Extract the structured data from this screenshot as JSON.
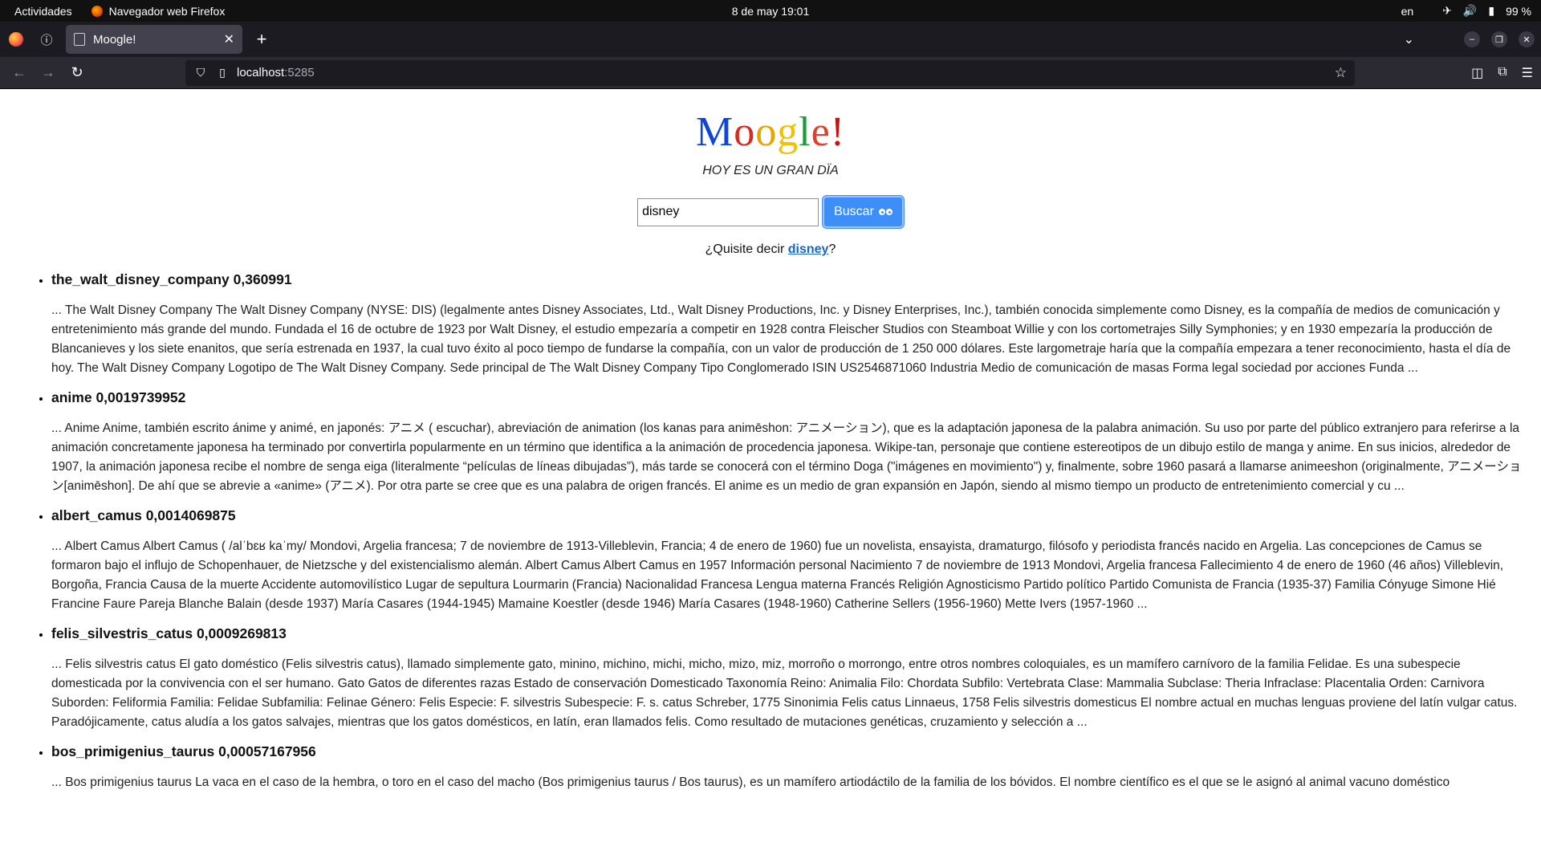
{
  "system": {
    "activities": "Actividades",
    "app_name": "Navegador web Firefox",
    "clock": "8 de may  19:01",
    "language": "en",
    "battery": "99 %"
  },
  "browser": {
    "tab_title": "Moogle!",
    "url_host": "localhost",
    "url_port": ":5285"
  },
  "page": {
    "logo_letters": [
      "M",
      "o",
      "o",
      "g",
      "l",
      "e",
      "!"
    ],
    "tagline": "HOY ES UN GRAN DÏA",
    "search_value": "disney",
    "search_button": "Buscar",
    "suggestion_prefix": "¿Quisite decir ",
    "suggestion_word": "disney",
    "suggestion_suffix": "?",
    "results": [
      {
        "heading": "the_walt_disney_company 0,360991",
        "snippet": "... The Walt Disney Company  The Walt Disney Company (NYSE: DIS) (legalmente antes Disney Associates, Ltd., Walt Disney Productions, Inc. y Disney Enterprises, Inc.), también conocida simplemente como Disney, es la compañía de medios de comunicación y entretenimiento más grande del mundo. Fundada el 16 de octubre de 1923 por Walt Disney, el estudio empezaría a competir en 1928 contra Fleischer Studios con Steamboat Willie y con los cortometrajes Silly Symphonies; y en 1930 empezaría la producción de Blancanieves y los siete enanitos, que sería estrenada en 1937, la cual tuvo éxito al poco tiempo de fundarse la compañía, con un valor de producción de 1 250 000 dólares. Este largometraje haría que la compañía empezara a tener reconocimiento, hasta el día de hoy. The Walt Disney Company  Logotipo de The Walt Disney Company.  Sede principal de The Walt Disney Company Tipo Conglomerado ISIN US2546871060 Industria Medio de comunicación de masas Forma legal sociedad por acciones Funda ..."
      },
      {
        "heading": "anime 0,0019739952",
        "snippet": "... Anime  Anime, también escrito ánime y animé, en japonés: アニメ ( escuchar), abreviación de animation (los kanas para animēshon: アニメーション), que es la adaptación japonesa de la palabra animación. Su uso por parte del público extranjero para referirse a la animación concretamente japonesa ha terminado por convertirla popularmente en un término que identifica a la animación de procedencia japonesa. Wikipe-tan, personaje que contiene estereotipos de un dibujo estilo de manga y anime.  En sus inicios, alrededor de 1907, la animación japonesa recibe el nombre de senga eiga (literalmente “películas de líneas dibujadas”), más tarde se conocerá con el término Doga (\"imágenes en movimiento\") y, finalmente, sobre 1960 pasará a llamarse animeeshon (originalmente, アニメーション[animēshon]. De ahí que se abrevie a «anime» (アニメ). Por otra parte se cree que es una palabra de origen francés. El anime es un medio de gran expansión en Japón, siendo al mismo tiempo un producto de entretenimiento comercial y cu ..."
      },
      {
        "heading": "albert_camus 0,0014069875",
        "snippet": "... Albert Camus  Albert Camus ( /alˈbɛʁ kaˈmy/ Mondovi, Argelia francesa; 7 de noviembre de 1913-Villeblevin, Francia; 4 de enero de 1960) fue un novelista, ensayista, dramaturgo, filósofo y periodista francés nacido en Argelia. Las concepciones de Camus se formaron bajo el influjo de Schopenhauer, de Nietzsche y del existencialismo alemán. Albert Camus  Albert Camus en 1957 Información personal Nacimiento 7 de noviembre de 1913 Mondovi, Argelia francesa Fallecimiento 4 de enero de 1960 (46 años) Villeblevin, Borgoña, Francia Causa de la muerte Accidente automovilístico Lugar de sepultura Lourmarin (Francia) Nacionalidad Francesa Lengua materna Francés Religión Agnosticismo Partido político Partido Comunista de Francia (1935-37) Familia Cónyuge Simone Hié Francine Faure Pareja   Blanche Balain (desde 1937) María Casares (1944-1945) Mamaine Koestler (desde 1946) María Casares (1948-1960) Catherine Sellers (1956-1960) Mette Ivers (1957-1960 ..."
      },
      {
        "heading": "felis_silvestris_catus 0,0009269813",
        "snippet": "... Felis silvestris catus  El gato doméstico (Felis silvestris catus), llamado simplemente gato, minino, michino, michi, micho, mizo, miz, morroño o morrongo, entre otros nombres coloquiales, es un mamífero carnívoro de la familia Felidae. Es una subespecie domesticada por la convivencia con el ser humano.  Gato  Gatos de diferentes razas Estado de conservación Domesticado Taxonomía Reino: Animalia Filo: Chordata Subfilo: Vertebrata Clase: Mammalia Subclase: Theria Infraclase: Placentalia Orden: Carnivora Suborden: Feliformia Familia: Felidae Subfamilia: Felinae Género: Felis Especie: F. silvestris Subespecie: F. s. catus Schreber, 1775 Sinonimia  Felis catus Linnaeus, 1758 Felis silvestris domesticus  El nombre actual en muchas lenguas proviene del latín vulgar catus. Paradójicamente, catus aludía a los gatos salvajes, mientras que los gatos domésticos, en latín, eran llamados felis.  Como resultado de mutaciones genéticas, cruzamiento y selección a ..."
      },
      {
        "heading": "bos_primigenius_taurus 0,00057167956",
        "snippet": "... Bos primigenius taurus  La vaca en el caso de la hembra, o toro en el caso del macho (Bos primigenius taurus / Bos taurus), es un mamífero artiodáctilo de la familia de los bóvidos. El nombre científico es el que se le asignó al animal vacuno doméstico"
      }
    ]
  }
}
